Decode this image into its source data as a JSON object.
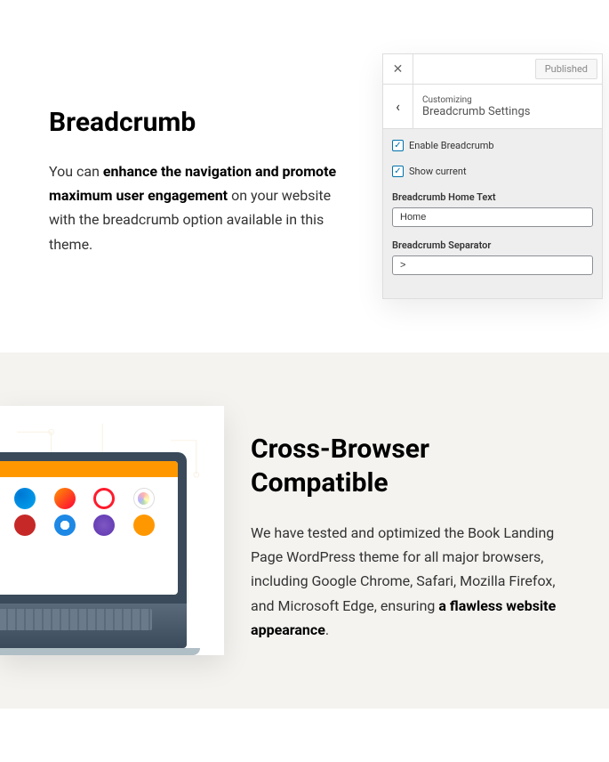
{
  "section1": {
    "heading": "Breadcrumb",
    "text_pre": "You can ",
    "text_bold": "enhance the navigation and promote maximum user engagement",
    "text_post": " on your website with the breadcrumb option available in this theme."
  },
  "panel": {
    "published": "Published",
    "customizing": "Customizing",
    "title": "Breadcrumb Settings",
    "enable_label": "Enable Breadcrumb",
    "show_current_label": "Show current",
    "home_text_label": "Breadcrumb Home Text",
    "home_text_value": "Home",
    "separator_label": "Breadcrumb Separator",
    "separator_value": ">"
  },
  "section2": {
    "heading": "Cross-Browser Compatible",
    "text_pre": "We have tested and optimized the Book Landing Page WordPress theme for all major browsers, including Google Chrome, Safari, Mozilla Firefox, and Microsoft Edge, ensuring ",
    "text_bold": "a flawless website appearance",
    "text_post": "."
  }
}
